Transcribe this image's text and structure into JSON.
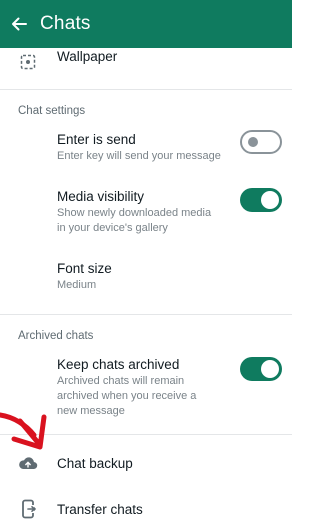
{
  "header": {
    "title": "Chats",
    "bg_color": "#0f7b5f"
  },
  "wallpaper": {
    "label": "Wallpaper",
    "icon": "wallpaper-icon"
  },
  "chat_settings": {
    "section_title": "Chat settings",
    "enter_is_send": {
      "label": "Enter is send",
      "description": "Enter key will send your message",
      "enabled": false
    },
    "media_visibility": {
      "label": "Media visibility",
      "description": "Show newly downloaded media in your device's gallery",
      "enabled": true
    },
    "font_size": {
      "label": "Font size",
      "value": "Medium"
    }
  },
  "archived_chats": {
    "section_title": "Archived chats",
    "keep_archived": {
      "label": "Keep chats archived",
      "description": "Archived chats will remain archived when you receive a new message",
      "enabled": true
    }
  },
  "chat_backup": {
    "label": "Chat backup",
    "icon": "cloud-upload-icon"
  },
  "transfer_chats": {
    "label": "Transfer chats",
    "icon": "transfer-phone-icon"
  },
  "annotation": {
    "arrow_color": "#d9121f"
  }
}
